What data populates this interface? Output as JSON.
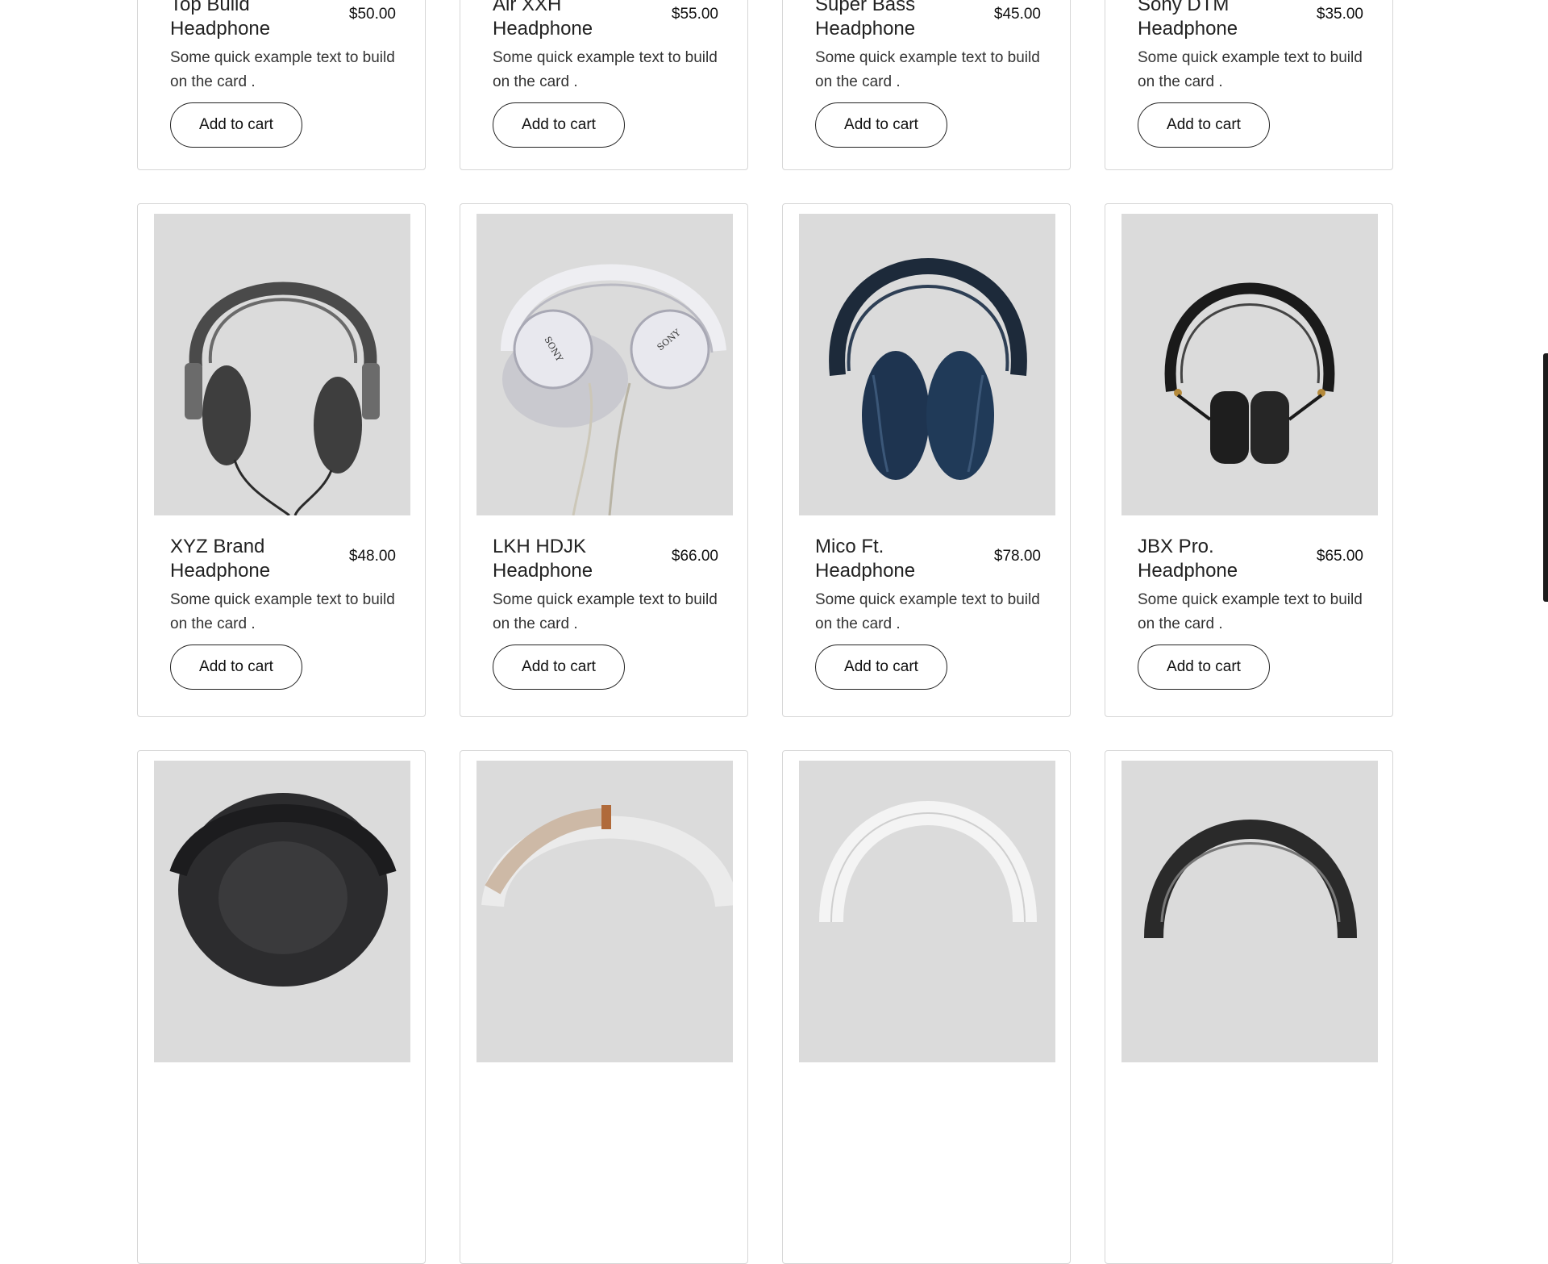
{
  "products_row1": [
    {
      "name": "Top Build Headphone",
      "price": "$50.00",
      "desc": "Some quick example text to build on the card .",
      "button": "Add to cart"
    },
    {
      "name": "Air XXH Headphone",
      "price": "$55.00",
      "desc": "Some quick example text to build on the card .",
      "button": "Add to cart"
    },
    {
      "name": "Super Bass Headphone",
      "price": "$45.00",
      "desc": "Some quick example text to build on the card .",
      "button": "Add to cart"
    },
    {
      "name": "Sony DTM Headphone",
      "price": "$35.00",
      "desc": "Some quick example text to build on the card .",
      "button": "Add to cart"
    }
  ],
  "products_row2": [
    {
      "name": "XYZ Brand Headphone",
      "price": "$48.00",
      "desc": "Some quick example text to build on the card .",
      "button": "Add to cart",
      "image": "grey-over-ear-headphone"
    },
    {
      "name": "LKH HDJK Headphone",
      "price": "$66.00",
      "desc": "Some quick example text to build on the card .",
      "button": "Add to cart",
      "image": "white-sony-headphone",
      "logo_text": "SONY"
    },
    {
      "name": "Mico Ft. Headphone",
      "price": "$78.00",
      "desc": "Some quick example text to build on the card .",
      "button": "Add to cart",
      "image": "navy-over-ear-headphone"
    },
    {
      "name": "JBX Pro. Headphone",
      "price": "$65.00",
      "desc": "Some quick example text to build on the card .",
      "button": "Add to cart",
      "image": "black-on-ear-headphone"
    }
  ],
  "products_row3": [
    {
      "image": "dark-headphone-topview"
    },
    {
      "image": "beige-headphone"
    },
    {
      "image": "white-headphone"
    },
    {
      "image": "black-headphone"
    }
  ],
  "colors": {
    "card_border": "#d6d6d6",
    "image_bg": "#dbdbdb",
    "button_border": "#222222"
  }
}
